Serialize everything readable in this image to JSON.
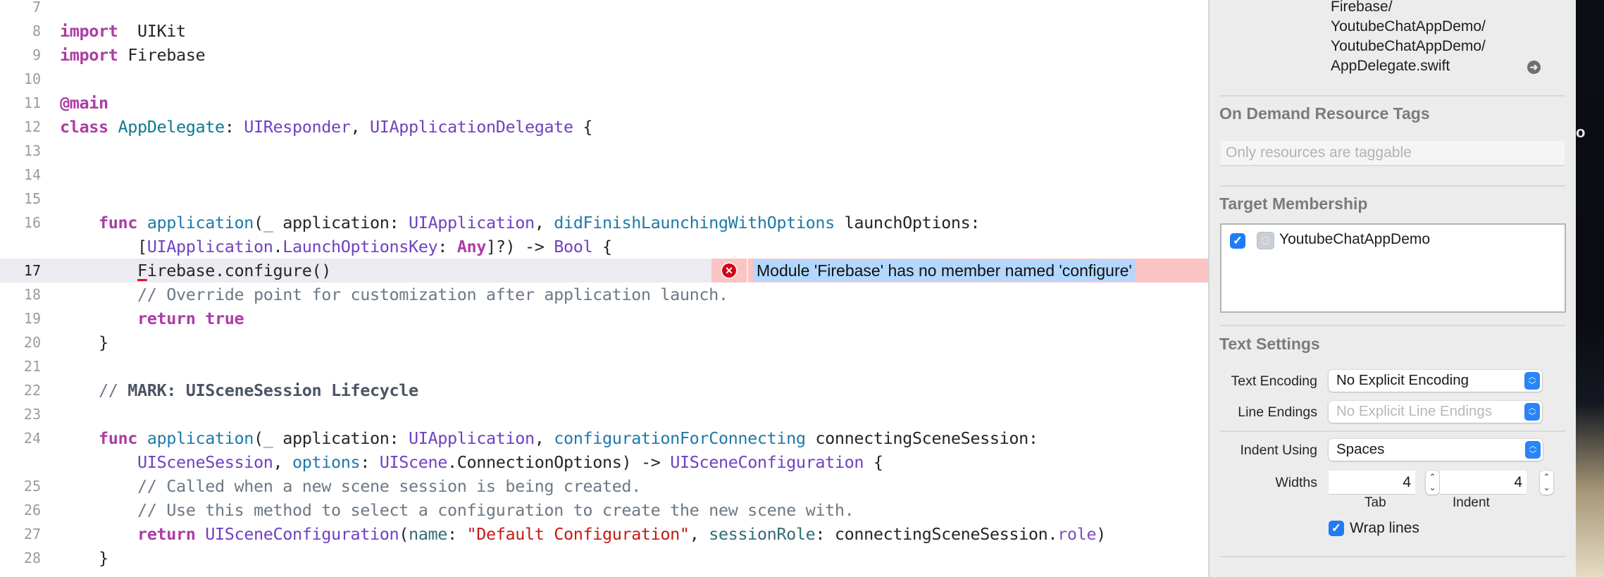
{
  "editor": {
    "current_line": 17,
    "lines": [
      {
        "n": "7",
        "tokens": []
      },
      {
        "n": "8",
        "tokens": [
          [
            "kw",
            "import"
          ],
          [
            "",
            "  UIKit"
          ]
        ]
      },
      {
        "n": "9",
        "tokens": [
          [
            "kw",
            "import"
          ],
          [
            "",
            " Firebase"
          ]
        ]
      },
      {
        "n": "10",
        "tokens": []
      },
      {
        "n": "11",
        "tokens": [
          [
            "kw",
            "@main"
          ]
        ]
      },
      {
        "n": "12",
        "tokens": [
          [
            "kw",
            "class"
          ],
          [
            "",
            " "
          ],
          [
            "cls",
            "AppDelegate"
          ],
          [
            "",
            ": "
          ],
          [
            "ty",
            "UIResponder"
          ],
          [
            "",
            ", "
          ],
          [
            "ty",
            "UIApplicationDelegate"
          ],
          [
            "",
            " {"
          ]
        ]
      },
      {
        "n": "13",
        "tokens": []
      },
      {
        "n": "14",
        "tokens": []
      },
      {
        "n": "15",
        "tokens": []
      },
      {
        "n": "16",
        "tokens": [
          [
            "",
            "    "
          ],
          [
            "kw",
            "func"
          ],
          [
            "",
            " "
          ],
          [
            "fn",
            "application"
          ],
          [
            "",
            "("
          ],
          [
            "fn",
            "_"
          ],
          [
            "",
            " application: "
          ],
          [
            "ty",
            "UIApplication"
          ],
          [
            "",
            ", "
          ],
          [
            "fn",
            "didFinishLaunchingWithOptions"
          ],
          [
            "",
            " launchOptions:"
          ]
        ]
      },
      {
        "n": "",
        "tokens": [
          [
            "",
            "        ["
          ],
          [
            "ty",
            "UIApplication"
          ],
          [
            "",
            "."
          ],
          [
            "ty",
            "LaunchOptionsKey"
          ],
          [
            "",
            ": "
          ],
          [
            "kw",
            "Any"
          ],
          [
            "",
            "]?) -> "
          ],
          [
            "ty",
            "Bool"
          ],
          [
            "",
            " {"
          ]
        ]
      },
      {
        "n": "17",
        "tokens": [
          [
            "",
            "        "
          ],
          [
            "err",
            "F"
          ],
          [
            "",
            "irebase.configure()"
          ]
        ]
      },
      {
        "n": "18",
        "tokens": [
          [
            "",
            "        "
          ],
          [
            "cm",
            "// Override point for customization after application launch."
          ]
        ]
      },
      {
        "n": "19",
        "tokens": [
          [
            "",
            "        "
          ],
          [
            "kw",
            "return"
          ],
          [
            "",
            " "
          ],
          [
            "kw",
            "true"
          ]
        ]
      },
      {
        "n": "20",
        "tokens": [
          [
            "",
            "    }"
          ]
        ]
      },
      {
        "n": "21",
        "tokens": []
      },
      {
        "n": "22",
        "tokens": [
          [
            "",
            "    "
          ],
          [
            "cm",
            "// "
          ],
          [
            "mark",
            "MARK: UISceneSession Lifecycle"
          ]
        ]
      },
      {
        "n": "23",
        "tokens": []
      },
      {
        "n": "24",
        "tokens": [
          [
            "",
            "    "
          ],
          [
            "kw",
            "func"
          ],
          [
            "",
            " "
          ],
          [
            "fn",
            "application"
          ],
          [
            "",
            "("
          ],
          [
            "fn",
            "_"
          ],
          [
            "",
            " application: "
          ],
          [
            "ty",
            "UIApplication"
          ],
          [
            "",
            ", "
          ],
          [
            "fn",
            "configurationForConnecting"
          ],
          [
            "",
            " connectingSceneSession:"
          ]
        ]
      },
      {
        "n": "",
        "tokens": [
          [
            "",
            "        "
          ],
          [
            "ty",
            "UISceneSession"
          ],
          [
            "",
            ", "
          ],
          [
            "fn",
            "options"
          ],
          [
            "",
            ": "
          ],
          [
            "ty",
            "UIScene"
          ],
          [
            "",
            ".ConnectionOptions) -> "
          ],
          [
            "ty",
            "UISceneConfiguration"
          ],
          [
            "",
            " {"
          ]
        ]
      },
      {
        "n": "25",
        "tokens": [
          [
            "",
            "        "
          ],
          [
            "cm",
            "// Called when a new scene session is being created."
          ]
        ]
      },
      {
        "n": "26",
        "tokens": [
          [
            "",
            "        "
          ],
          [
            "cm",
            "// Use this method to select a configuration to create the new scene with."
          ]
        ]
      },
      {
        "n": "27",
        "tokens": [
          [
            "",
            "        "
          ],
          [
            "kw",
            "return"
          ],
          [
            "",
            " "
          ],
          [
            "ty",
            "UISceneConfiguration"
          ],
          [
            "",
            "("
          ],
          [
            "prm",
            "name"
          ],
          [
            "",
            ": "
          ],
          [
            "str",
            "\"Default Configuration\""
          ],
          [
            "",
            ", "
          ],
          [
            "prm",
            "sessionRole"
          ],
          [
            "",
            ": connectingSceneSession."
          ],
          [
            "prop",
            "role"
          ],
          [
            "",
            ")"
          ]
        ]
      },
      {
        "n": "28",
        "tokens": [
          [
            "",
            "    }"
          ]
        ]
      }
    ],
    "error": {
      "icon": "error-x-icon",
      "message": "Module 'Firebase' has no member named 'configure'"
    }
  },
  "inspector": {
    "full_path": [
      "Firebase/",
      "YoutubeChatAppDemo/",
      "YoutubeChatAppDemo/",
      "AppDelegate.swift"
    ],
    "reveal_icon": "arrow-right-circle-icon",
    "on_demand": {
      "title": "On Demand Resource Tags",
      "placeholder": "Only resources are taggable"
    },
    "target_membership": {
      "title": "Target Membership",
      "targets": [
        {
          "name": "YoutubeChatAppDemo",
          "checked": true
        }
      ]
    },
    "text_settings": {
      "title": "Text Settings",
      "text_encoding_label": "Text Encoding",
      "text_encoding_value": "No Explicit Encoding",
      "line_endings_label": "Line Endings",
      "line_endings_value": "No Explicit Line Endings",
      "indent_using_label": "Indent Using",
      "indent_using_value": "Spaces",
      "widths_label": "Widths",
      "tab_width": "4",
      "tab_label": "Tab",
      "indent_width": "4",
      "indent_label": "Indent",
      "wrap_lines_label": "Wrap lines",
      "wrap_lines_checked": true
    }
  },
  "desktop": {
    "partial_text": "o"
  }
}
